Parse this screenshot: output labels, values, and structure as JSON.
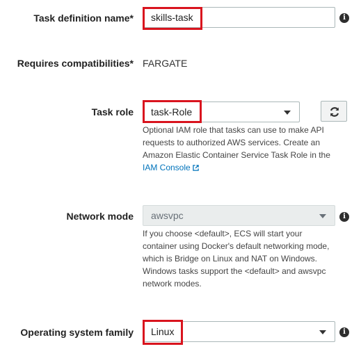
{
  "task_definition_name": {
    "label": "Task definition name*",
    "value": "skills-task"
  },
  "requires_compatibilities": {
    "label": "Requires compatibilities*",
    "value": "FARGATE"
  },
  "task_role": {
    "label": "Task role",
    "selected": "task-Role",
    "help_text": "Optional IAM role that tasks can use to make API requests to authorized AWS services. Create an Amazon Elastic Container Service Task Role in the",
    "link_text": "IAM Console"
  },
  "network_mode": {
    "label": "Network mode",
    "selected": "awsvpc",
    "help_text": "If you choose <default>, ECS will start your container using Docker's default networking mode, which is Bridge on Linux and NAT on Windows. Windows tasks support the <default> and awsvpc network modes."
  },
  "operating_system_family": {
    "label": "Operating system family",
    "selected": "Linux"
  },
  "icons": {
    "info": "info-icon",
    "refresh": "refresh-icon",
    "dropdown": "chevron-down-icon",
    "external_link": "external-link-icon"
  },
  "colors": {
    "highlight": "#d9141e",
    "link": "#0073bb"
  }
}
